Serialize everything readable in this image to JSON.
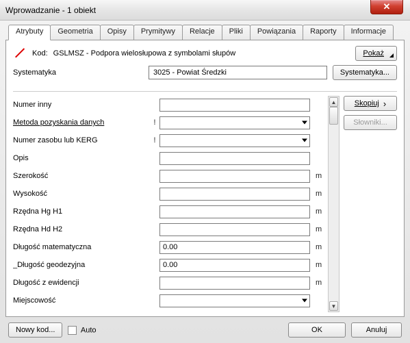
{
  "window": {
    "title": "Wprowadzanie - 1 obiekt"
  },
  "tabs": {
    "atrybuty": "Atrybuty",
    "geometria": "Geometria",
    "opisy": "Opisy",
    "prymitywy": "Prymitywy",
    "relacje": "Relacje",
    "pliki": "Pliki",
    "powiazania": "Powiązania",
    "raporty": "Raporty",
    "informacje": "Informacje"
  },
  "header": {
    "kod_label": "Kod:",
    "kod_value": "GSLMSZ - Podpora wielosłupowa z symbolami słupów",
    "pokaz_btn": "Pokaż",
    "systematyka_label": "Systematyka",
    "systematyka_value": "3025 - Powiat Średzki",
    "systematyka_btn": "Systematyka..."
  },
  "side": {
    "skopiuj": "Skopiuj",
    "slowniki": "Słowniki..."
  },
  "attrs": [
    {
      "label": "Numer inny",
      "type": "text",
      "value": "",
      "mark": "",
      "unit": "",
      "underline": false
    },
    {
      "label": "Metoda pozyskania danych",
      "type": "combo",
      "value": "",
      "mark": "!",
      "unit": "",
      "underline": true
    },
    {
      "label": "Numer zasobu lub KERG",
      "type": "combo",
      "value": "",
      "mark": "!",
      "unit": "",
      "underline": false
    },
    {
      "label": "Opis",
      "type": "text",
      "value": "",
      "mark": "",
      "unit": "",
      "underline": false
    },
    {
      "label": "Szerokość",
      "type": "text",
      "value": "",
      "mark": "",
      "unit": "m",
      "underline": false
    },
    {
      "label": "Wysokość",
      "type": "text",
      "value": "",
      "mark": "",
      "unit": "m",
      "underline": false
    },
    {
      "label": "Rzędna Hg H1",
      "type": "text",
      "value": "",
      "mark": "",
      "unit": "m",
      "underline": false
    },
    {
      "label": "Rzędna Hd H2",
      "type": "text",
      "value": "",
      "mark": "",
      "unit": "m",
      "underline": false
    },
    {
      "label": "Długość matematyczna",
      "type": "text",
      "value": "0.00",
      "mark": "",
      "unit": "m",
      "underline": false
    },
    {
      "label": "_Długość geodezyjna",
      "type": "text",
      "value": "0.00",
      "mark": "",
      "unit": "m",
      "underline": false
    },
    {
      "label": "Długość z ewidencji",
      "type": "text",
      "value": "",
      "mark": "",
      "unit": "m",
      "underline": false
    },
    {
      "label": "Miejscowość",
      "type": "combo",
      "value": "",
      "mark": "",
      "unit": "",
      "underline": false
    }
  ],
  "footer": {
    "nowy_kod": "Nowy kod...",
    "auto": "Auto",
    "ok": "OK",
    "anuluj": "Anuluj"
  }
}
